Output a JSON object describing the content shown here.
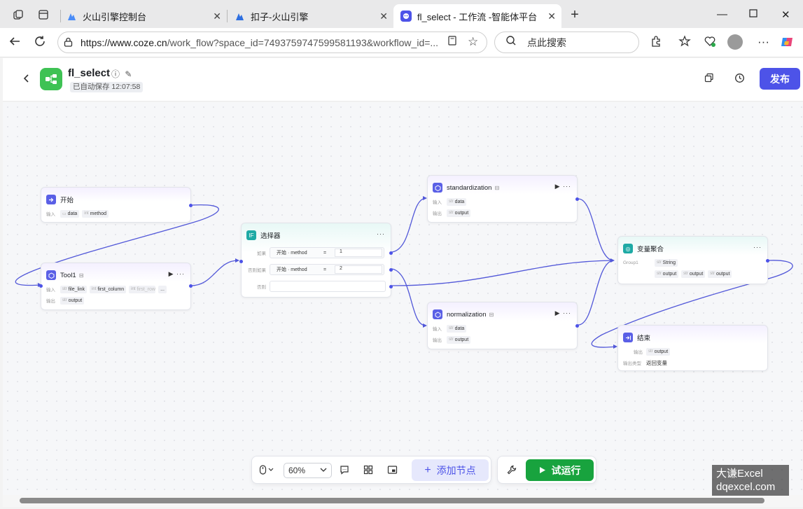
{
  "browser": {
    "tabs": [
      {
        "label": "火山引擎控制台",
        "active": false
      },
      {
        "label": "扣子-火山引擎",
        "active": false
      },
      {
        "label": "fl_select - 工作流 -智能体平台",
        "active": true
      }
    ],
    "url_host": "https://www.coze.cn",
    "url_rest": "/work_flow?space_id=7493759747599581193&workflow_id=...",
    "search_placeholder": "点此搜索",
    "accent_color": "#4d53e8"
  },
  "header": {
    "title": "fl_select",
    "autosave": "已自动保存 12:07:58",
    "publish_label": "发布"
  },
  "nodes": {
    "start": {
      "title": "开始",
      "input_label": "输入",
      "inputs": [
        {
          "type": "",
          "name": "data"
        },
        {
          "type": "int",
          "name": "method"
        }
      ]
    },
    "tool1": {
      "title": "Tool1",
      "input_label": "输入",
      "output_label": "输出",
      "inputs": [
        {
          "type": "str",
          "name": "file_link"
        },
        {
          "type": "int",
          "name": "first_column"
        },
        {
          "type": "int",
          "name": "first_row"
        }
      ],
      "more": "...",
      "output": {
        "type": "str",
        "name": "output"
      }
    },
    "selector": {
      "title": "选择器",
      "if_label": "如果",
      "elif_label": "否则如果",
      "else_label": "否则",
      "conditions": [
        {
          "source": "开始",
          "var": "method",
          "op": "=",
          "value": "1"
        },
        {
          "source": "开始",
          "var": "method",
          "op": "=",
          "value": "2"
        }
      ]
    },
    "standardization": {
      "title": "standardization",
      "input_label": "输入",
      "output_label": "输出",
      "input": {
        "type": "str",
        "name": "data"
      },
      "output": {
        "type": "str",
        "name": "output"
      }
    },
    "normalization": {
      "title": "normalization",
      "input_label": "输入",
      "output_label": "输出",
      "input": {
        "type": "str",
        "name": "data"
      },
      "output": {
        "type": "str",
        "name": "output"
      }
    },
    "aggregate": {
      "title": "变量聚合",
      "group_label": "Group1",
      "group_type": {
        "type": "str",
        "name": "String"
      },
      "items": [
        {
          "type": "str",
          "name": "output"
        },
        {
          "type": "str",
          "name": "output"
        },
        {
          "type": "str",
          "name": "output"
        }
      ]
    },
    "end": {
      "title": "结束",
      "output_label": "输出",
      "output": {
        "type": "str",
        "name": "output"
      },
      "output_type_label": "输出类型",
      "output_type_value": "返回变量"
    }
  },
  "toolbar": {
    "zoom": "60%",
    "add_node_label": "添加节点",
    "run_label": "试运行"
  },
  "watermark": {
    "line1": "大谦Excel",
    "line2": "dqexcel.com"
  }
}
